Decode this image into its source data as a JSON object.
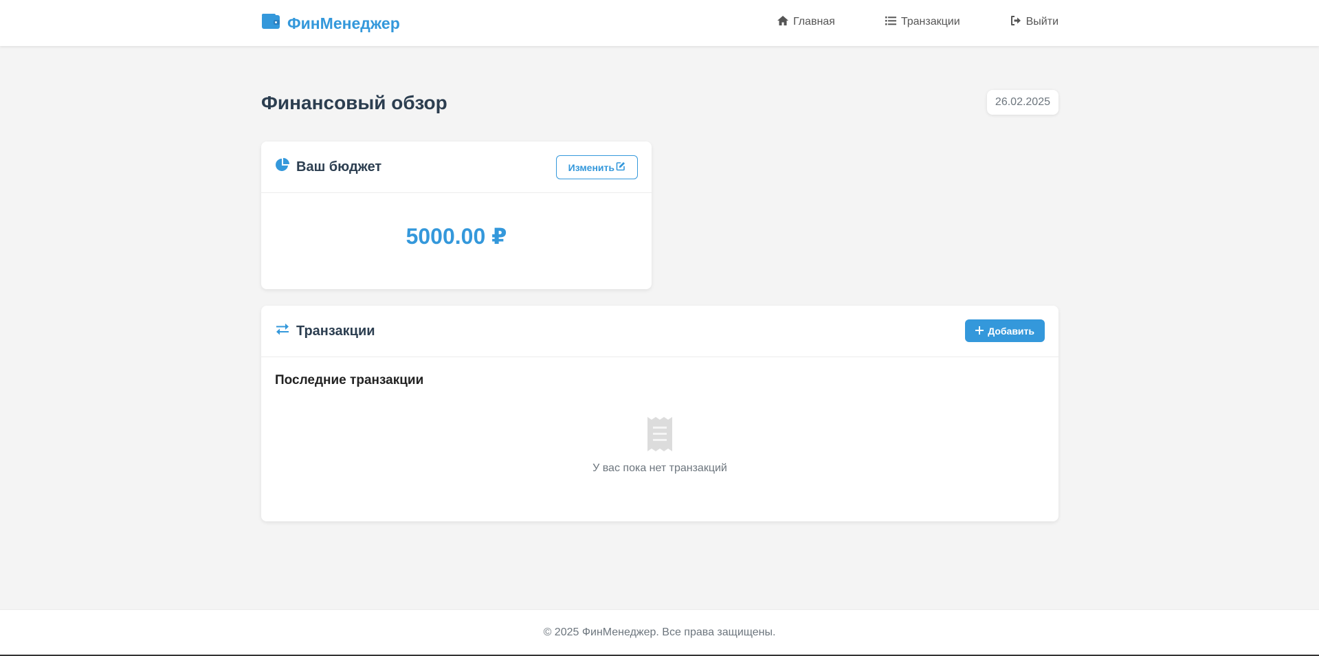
{
  "navbar": {
    "brand": "ФинМенеджер",
    "brand_icon": "wallet-icon",
    "links": [
      {
        "label": "Главная",
        "icon": "home-icon"
      },
      {
        "label": "Транзакции",
        "icon": "list-icon"
      },
      {
        "label": "Выйти",
        "icon": "sign-out-icon"
      }
    ]
  },
  "main": {
    "title": "Финансовый обзор",
    "date": "26.02.2025"
  },
  "budget": {
    "title": "Ваш бюджет",
    "icon": "pie-chart-icon",
    "edit_label": "Изменить",
    "edit_icon": "edit-icon",
    "amount": "5000.00 ₽"
  },
  "transactions": {
    "title": "Транзакции",
    "icon": "exchange-icon",
    "add_label": "Добавить",
    "add_icon": "plus-icon",
    "recent_title": "Последние транзакции",
    "empty_icon": "receipt-icon",
    "empty_text": "У вас пока нет транзакций"
  },
  "footer": {
    "text": "© 2025 ФинМенеджер. Все права защищены."
  },
  "colors": {
    "accent": "#3498db",
    "background": "#f4f4f4",
    "heading": "#2c3e50",
    "muted": "#6c757d"
  }
}
